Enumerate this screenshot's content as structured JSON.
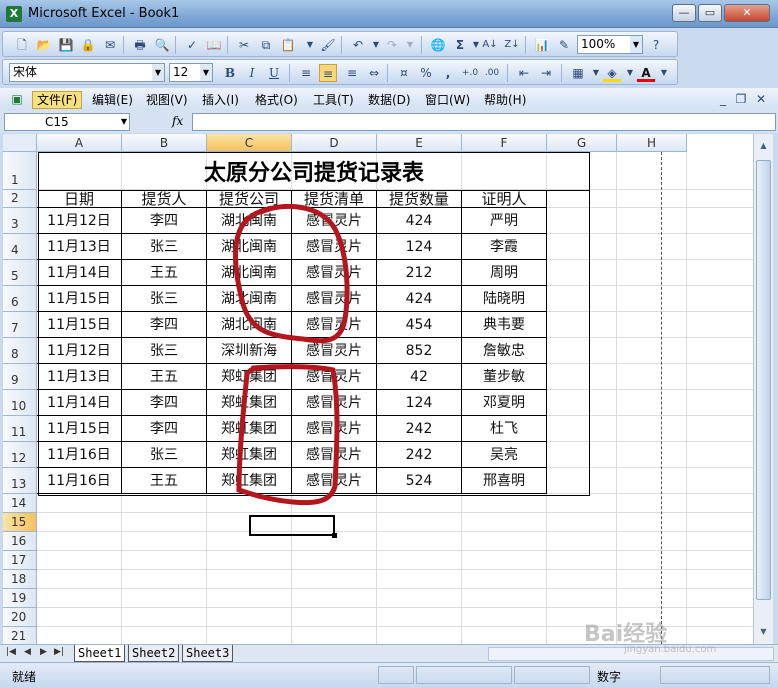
{
  "window": {
    "title": "Microsoft Excel - Book1",
    "app_icon": "X"
  },
  "standard_toolbar": {
    "zoom": "100%"
  },
  "formatting_toolbar": {
    "font_name": "宋体",
    "font_size": "12",
    "bold": "B",
    "italic": "I",
    "underline": "U",
    "percent": "%",
    "comma": ","
  },
  "menu": [
    "文件(F)",
    "编辑(E)",
    "视图(V)",
    "插入(I)",
    "格式(O)",
    "工具(T)",
    "数据(D)",
    "窗口(W)",
    "帮助(H)"
  ],
  "formula_bar": {
    "name_box": "C15",
    "fx": "fx",
    "value": ""
  },
  "columns": [
    "A",
    "B",
    "C",
    "D",
    "E",
    "F",
    "G",
    "H"
  ],
  "selected_column": "C",
  "rows": [
    "1",
    "2",
    "3",
    "4",
    "5",
    "6",
    "7",
    "8",
    "9",
    "10",
    "11",
    "12",
    "13",
    "14",
    "15",
    "16",
    "17",
    "18",
    "19",
    "20",
    "21"
  ],
  "selected_row": "15",
  "sheet": {
    "title": "太原分公司提货记录表",
    "headers": [
      "日期",
      "提货人",
      "提货公司",
      "提货清单",
      "提货数量",
      "证明人"
    ],
    "records": [
      [
        "11月12日",
        "李四",
        "湖北闽南",
        "感冒灵片",
        "424",
        "严明"
      ],
      [
        "11月13日",
        "张三",
        "湖北闽南",
        "感冒灵片",
        "124",
        "李霞"
      ],
      [
        "11月14日",
        "王五",
        "湖北闽南",
        "感冒灵片",
        "212",
        "周明"
      ],
      [
        "11月15日",
        "张三",
        "湖北闽南",
        "感冒灵片",
        "424",
        "陆晓明"
      ],
      [
        "11月15日",
        "李四",
        "湖北闽南",
        "感冒灵片",
        "454",
        "典韦要"
      ],
      [
        "11月12日",
        "张三",
        "深圳新海",
        "感冒灵片",
        "852",
        "詹敏忠"
      ],
      [
        "11月13日",
        "王五",
        "郑虹集团",
        "感冒灵片",
        "42",
        "董步敏"
      ],
      [
        "11月14日",
        "李四",
        "郑虹集团",
        "感冒灵片",
        "124",
        "邓夏明"
      ],
      [
        "11月15日",
        "李四",
        "郑虹集团",
        "感冒灵片",
        "242",
        "杜飞"
      ],
      [
        "11月16日",
        "张三",
        "郑虹集团",
        "感冒灵片",
        "242",
        "吴亮"
      ],
      [
        "11月16日",
        "王五",
        "郑虹集团",
        "感冒灵片",
        "524",
        "邢喜明"
      ]
    ]
  },
  "annotation_color": "#b3161c",
  "sheet_tabs": [
    "Sheet1",
    "Sheet2",
    "Sheet3"
  ],
  "status": {
    "ready": "就绪",
    "mode": "数字"
  },
  "watermark": {
    "brand": "Bai经验",
    "url": "jingyan.baidu.com"
  }
}
